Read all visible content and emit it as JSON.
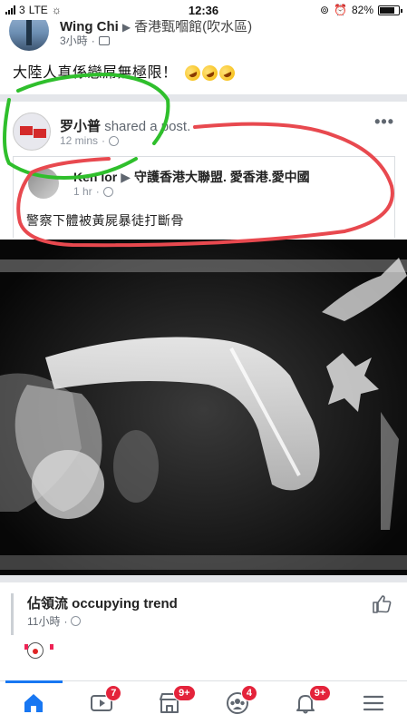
{
  "status_bar": {
    "carrier": "3",
    "network": "LTE",
    "time": "12:36",
    "battery": "82%",
    "battery_level": 0.82
  },
  "top_post": {
    "author": "Wing Chi",
    "target": "香港甄嗰館(吹水區)",
    "time": "3小時",
    "body": "大陸人真係戀屌無極限！"
  },
  "shared_post": {
    "sharer": "罗小普",
    "action": "shared a post.",
    "time": "12 mins",
    "more": "•••",
    "original": {
      "author": "Ken lor",
      "target": "守護香港大聯盟. 愛香港.愛中國",
      "time": "1 hr",
      "text": "警察下體被黃屍暴徒打斷骨"
    }
  },
  "next_post": {
    "title": "佔領流 occupying trend",
    "time": "11小時"
  },
  "bottom_nav": {
    "items": [
      {
        "name": "home",
        "badge": ""
      },
      {
        "name": "watch",
        "badge": "7"
      },
      {
        "name": "marketplace",
        "badge": "9+"
      },
      {
        "name": "groups",
        "badge": "4"
      },
      {
        "name": "notifications",
        "badge": "9+"
      },
      {
        "name": "menu",
        "badge": ""
      }
    ]
  },
  "colors": {
    "accent": "#1877f2",
    "badge": "#e4233b",
    "green_marker": "#2fbf2c",
    "red_marker": "#e8494f"
  }
}
